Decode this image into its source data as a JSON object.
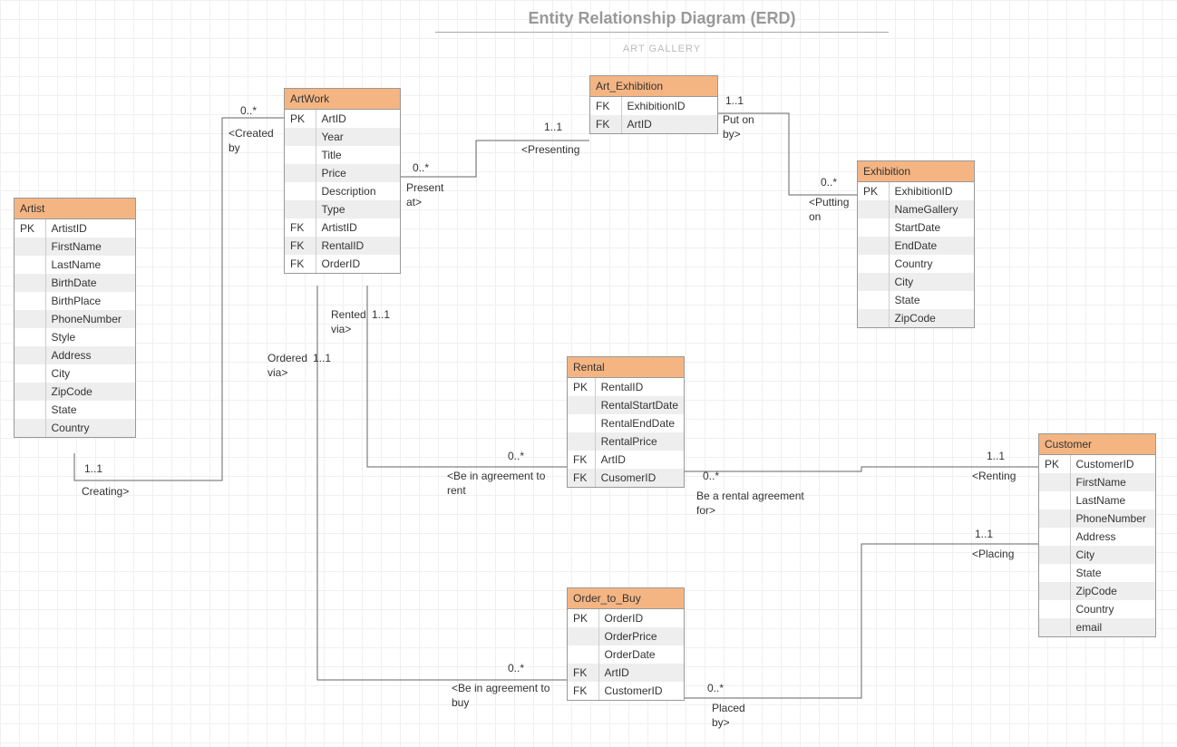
{
  "title": "Entity Relationship Diagram (ERD)",
  "subtitle": "ART GALLERY",
  "entities": {
    "artist": {
      "name": "Artist",
      "rows": [
        {
          "key": "PK",
          "field": "ArtistID"
        },
        {
          "key": "",
          "field": "FirstName"
        },
        {
          "key": "",
          "field": "LastName"
        },
        {
          "key": "",
          "field": "BirthDate"
        },
        {
          "key": "",
          "field": "BirthPlace"
        },
        {
          "key": "",
          "field": "PhoneNumber"
        },
        {
          "key": "",
          "field": "Style"
        },
        {
          "key": "",
          "field": "Address"
        },
        {
          "key": "",
          "field": "City"
        },
        {
          "key": "",
          "field": "ZipCode"
        },
        {
          "key": "",
          "field": "State"
        },
        {
          "key": "",
          "field": "Country"
        }
      ]
    },
    "artwork": {
      "name": "ArtWork",
      "rows": [
        {
          "key": "PK",
          "field": "ArtID"
        },
        {
          "key": "",
          "field": "Year"
        },
        {
          "key": "",
          "field": "Title"
        },
        {
          "key": "",
          "field": "Price"
        },
        {
          "key": "",
          "field": "Description"
        },
        {
          "key": "",
          "field": "Type"
        },
        {
          "key": "FK",
          "field": "ArtistID"
        },
        {
          "key": "FK",
          "field": "RentalID"
        },
        {
          "key": "FK",
          "field": "OrderID"
        }
      ]
    },
    "art_exhibition": {
      "name": "Art_Exhibition",
      "rows": [
        {
          "key": "FK",
          "field": "ExhibitionID"
        },
        {
          "key": "FK",
          "field": "ArtID"
        }
      ]
    },
    "exhibition": {
      "name": "Exhibition",
      "rows": [
        {
          "key": "PK",
          "field": "ExhibitionID"
        },
        {
          "key": "",
          "field": "NameGallery"
        },
        {
          "key": "",
          "field": "StartDate"
        },
        {
          "key": "",
          "field": "EndDate"
        },
        {
          "key": "",
          "field": "Country"
        },
        {
          "key": "",
          "field": "City"
        },
        {
          "key": "",
          "field": "State"
        },
        {
          "key": "",
          "field": "ZipCode"
        }
      ]
    },
    "rental": {
      "name": "Rental",
      "rows": [
        {
          "key": "PK",
          "field": "RentalID"
        },
        {
          "key": "",
          "field": "RentalStartDate"
        },
        {
          "key": "",
          "field": "RentalEndDate"
        },
        {
          "key": "",
          "field": "RentalPrice"
        },
        {
          "key": "FK",
          "field": "ArtID"
        },
        {
          "key": "FK",
          "field": "CusomerID"
        }
      ]
    },
    "order": {
      "name": "Order_to_Buy",
      "rows": [
        {
          "key": "PK",
          "field": "OrderID"
        },
        {
          "key": "",
          "field": "OrderPrice"
        },
        {
          "key": "",
          "field": "OrderDate"
        },
        {
          "key": "FK",
          "field": "ArtID"
        },
        {
          "key": "FK",
          "field": "CustomerID"
        }
      ]
    },
    "customer": {
      "name": "Customer",
      "rows": [
        {
          "key": "PK",
          "field": "CustomerID"
        },
        {
          "key": "",
          "field": "FirstName"
        },
        {
          "key": "",
          "field": "LastName"
        },
        {
          "key": "",
          "field": "PhoneNumber"
        },
        {
          "key": "",
          "field": "Address"
        },
        {
          "key": "",
          "field": "City"
        },
        {
          "key": "",
          "field": "State"
        },
        {
          "key": "",
          "field": "ZipCode"
        },
        {
          "key": "",
          "field": "Country"
        },
        {
          "key": "",
          "field": "email"
        }
      ]
    }
  },
  "labels": {
    "created_by_card": "0..*",
    "created_by": "<Created\nby",
    "creating_card": "1..1",
    "creating": "Creating>",
    "present_at_card": "0..*",
    "present_at": "Present\nat>",
    "presenting_card": "1..1",
    "presenting": "<Presenting",
    "put_on_by_card": "1..1",
    "put_on_by": "Put on\nby>",
    "putting_on_card": "0..*",
    "putting_on": "<Putting\non",
    "rented_via": "Rented\nvia>",
    "rented_via_card": "1..1",
    "ordered_via": "Ordered\nvia>",
    "ordered_via_card": "1..1",
    "agree_rent_card": "0..*",
    "agree_rent": "<Be in agreement to\nrent",
    "rental_for_card": "0..*",
    "rental_for": "Be a rental agreement\nfor>",
    "renting_card": "1..1",
    "renting": "<Renting",
    "agree_buy_card": "0..*",
    "agree_buy": "<Be in agreement to\nbuy",
    "placed_by_card": "0..*",
    "placed_by": "Placed\nby>",
    "placing_card": "1..1",
    "placing": "<Placing"
  }
}
